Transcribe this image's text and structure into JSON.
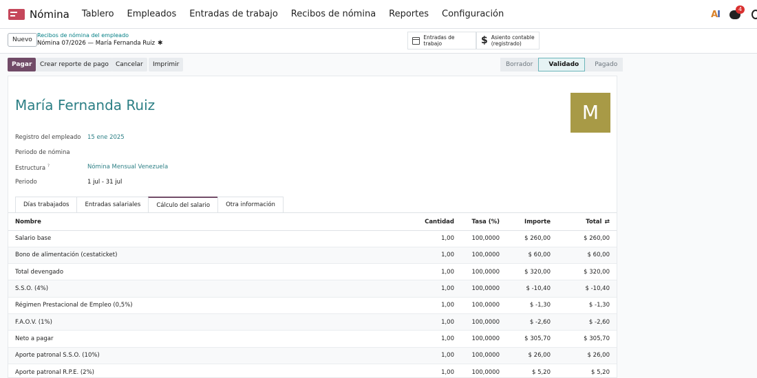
{
  "navbar": {
    "app_name": "Nómina",
    "menu": [
      "Tablero",
      "Empleados",
      "Entradas de trabajo",
      "Recibos de nómina",
      "Reportes",
      "Configuración"
    ],
    "chat_badge": "4"
  },
  "control_panel": {
    "new_label": "Nuevo",
    "breadcrumb_parent": "Recibos de nómina del empleado",
    "breadcrumb_current": "Nómina 07/2026 — María Fernanda Ruiz",
    "smart_entries": "Entradas de trabajo",
    "smart_account_line1": "Asiento contable",
    "smart_account_line2": "(registrado)"
  },
  "actions": {
    "pay": "Pagar",
    "report": "Crear reporte de pago",
    "cancel": "Cancelar",
    "print": "Imprimir"
  },
  "statusbar": [
    "Borrador",
    "Validado",
    "Pagado"
  ],
  "employee": {
    "name": "María Fernanda Ruiz",
    "avatar_letter": "M",
    "avatar_color": "#a89a46"
  },
  "fields": {
    "registro_label": "Registro del empleado",
    "registro_value": "15 ene 2025",
    "periodo_nomina_label": "Periodo de nómina",
    "estructura_label": "Estructura",
    "estructura_tooltip": "?",
    "estructura_value": "Nómina Mensual Venezuela",
    "periodo_label": "Periodo",
    "periodo_value": "1 jul - 31 jul"
  },
  "tabs": [
    "Días trabajados",
    "Entradas salariales",
    "Cálculo del salario",
    "Otra información"
  ],
  "table": {
    "headers": [
      "Nombre",
      "Cantidad",
      "Tasa (%)",
      "Importe",
      "Total"
    ],
    "rows": [
      [
        "Salario base",
        "1,00",
        "100,0000",
        "$ 260,00",
        "$ 260,00"
      ],
      [
        "Bono de alimentación (cestaticket)",
        "1,00",
        "100,0000",
        "$ 60,00",
        "$ 60,00"
      ],
      [
        "Total devengado",
        "1,00",
        "100,0000",
        "$ 320,00",
        "$ 320,00"
      ],
      [
        "S.S.O. (4%)",
        "1,00",
        "100,0000",
        "$ -10,40",
        "$ -10,40"
      ],
      [
        "Régimen Prestacional de Empleo (0,5%)",
        "1,00",
        "100,0000",
        "$ -1,30",
        "$ -1,30"
      ],
      [
        "F.A.O.V. (1%)",
        "1,00",
        "100,0000",
        "$ -2,60",
        "$ -2,60"
      ],
      [
        "Neto a pagar",
        "1,00",
        "100,0000",
        "$ 305,70",
        "$ 305,70"
      ],
      [
        "Aporte patronal S.S.O. (10%)",
        "1,00",
        "100,0000",
        "$ 26,00",
        "$ 26,00"
      ],
      [
        "Aporte patronal R.P.E. (2%)",
        "1,00",
        "100,0000",
        "$ 5,20",
        "$ 5,20"
      ]
    ]
  },
  "colors": {
    "brand": "#714b67",
    "accent": "#2c7f85"
  }
}
